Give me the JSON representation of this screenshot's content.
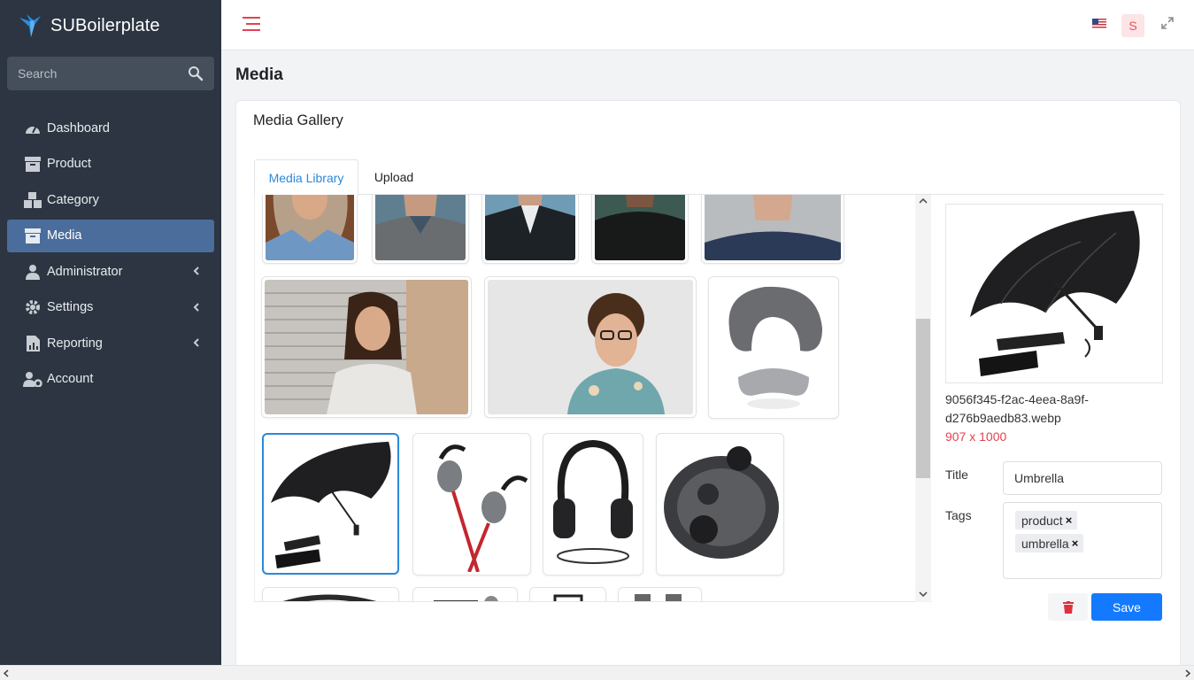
{
  "brand": {
    "name": "SUBoilerplate"
  },
  "search": {
    "placeholder": "Search"
  },
  "sidebar": {
    "items": [
      {
        "label": "Dashboard",
        "icon": "gauge-icon",
        "active": false,
        "has_submenu": false
      },
      {
        "label": "Product",
        "icon": "archive-box-icon",
        "active": false,
        "has_submenu": false
      },
      {
        "label": "Category",
        "icon": "boxes-icon",
        "active": false,
        "has_submenu": false
      },
      {
        "label": "Media",
        "icon": "archive-box-icon",
        "active": true,
        "has_submenu": false
      },
      {
        "label": "Administrator",
        "icon": "user-tie-icon",
        "active": false,
        "has_submenu": true
      },
      {
        "label": "Settings",
        "icon": "gear-icon",
        "active": false,
        "has_submenu": true
      },
      {
        "label": "Reporting",
        "icon": "chart-file-icon",
        "active": false,
        "has_submenu": true
      },
      {
        "label": "Account",
        "icon": "user-gear-icon",
        "active": false,
        "has_submenu": false
      }
    ]
  },
  "header": {
    "user_initial": "S",
    "flag": "us-flag-icon"
  },
  "page": {
    "title": "Media"
  },
  "card": {
    "title": "Media Gallery"
  },
  "tabs": [
    {
      "label": "Media Library",
      "active": true
    },
    {
      "label": "Upload",
      "active": false
    }
  ],
  "gallery": {
    "items": [
      {
        "subject": "woman-denim-jacket",
        "selected": false
      },
      {
        "subject": "man-grey-sweater",
        "selected": false
      },
      {
        "subject": "man-blazer",
        "selected": false
      },
      {
        "subject": "man-dark-shirt",
        "selected": false
      },
      {
        "subject": "man-navy-tshirt",
        "selected": false
      },
      {
        "subject": "man-dreadlocks",
        "selected": false
      },
      {
        "subject": "man-curly-hair-glasses",
        "selected": false
      },
      {
        "subject": "travel-pillow-eye-mask",
        "selected": false
      },
      {
        "subject": "umbrella",
        "selected": true
      },
      {
        "subject": "earphones",
        "selected": false
      },
      {
        "subject": "headphones",
        "selected": false
      },
      {
        "subject": "earbuds-case",
        "selected": false
      }
    ]
  },
  "detail": {
    "filename": "9056f345-f2ac-4eea-8a9f-d276b9aedb83.webp",
    "dimensions": "907 x 1000",
    "title_label": "Title",
    "title_value": "Umbrella",
    "tags_label": "Tags",
    "tags": [
      "product",
      "umbrella"
    ],
    "save_label": "Save"
  },
  "colors": {
    "sidebar_bg": "#2c3541",
    "active_item": "#4a6d9c",
    "accent_blue": "#2b89d8",
    "save_button": "#137aff",
    "dims_red": "#e0434f"
  }
}
